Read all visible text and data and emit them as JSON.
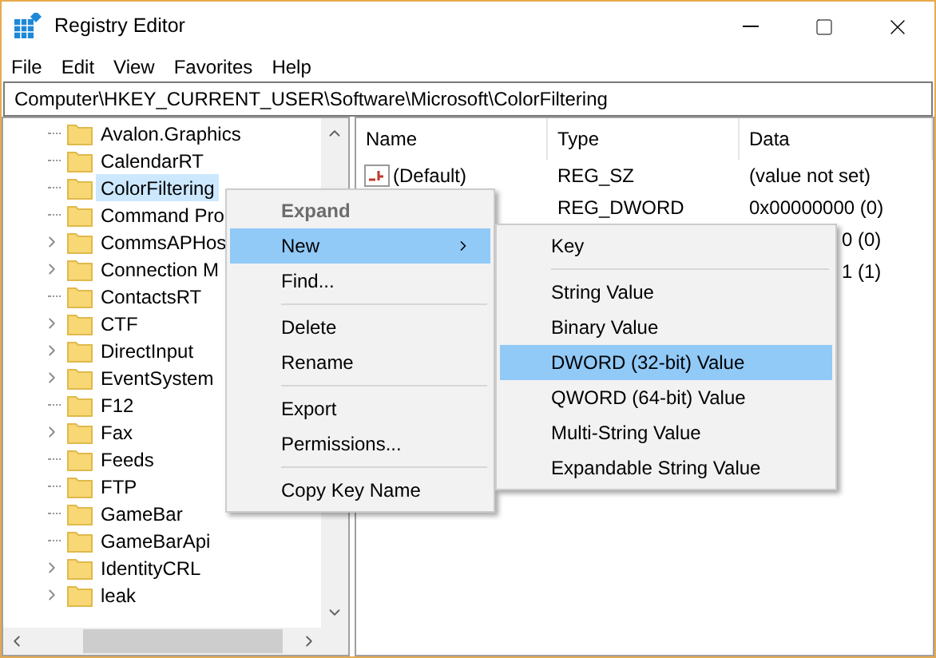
{
  "window": {
    "title": "Registry Editor"
  },
  "menu_bar": [
    "File",
    "Edit",
    "View",
    "Favorites",
    "Help"
  ],
  "address_bar": "Computer\\HKEY_CURRENT_USER\\Software\\Microsoft\\ColorFiltering",
  "tree": {
    "items": [
      {
        "label": "Avalon.Graphics",
        "expandable": false,
        "selected": false
      },
      {
        "label": "CalendarRT",
        "expandable": false,
        "selected": false
      },
      {
        "label": "ColorFiltering",
        "expandable": false,
        "selected": true
      },
      {
        "label": "Command Pro",
        "expandable": false,
        "selected": false
      },
      {
        "label": "CommsAPHos",
        "expandable": true,
        "selected": false
      },
      {
        "label": "Connection M",
        "expandable": true,
        "selected": false
      },
      {
        "label": "ContactsRT",
        "expandable": false,
        "selected": false
      },
      {
        "label": "CTF",
        "expandable": true,
        "selected": false
      },
      {
        "label": "DirectInput",
        "expandable": true,
        "selected": false
      },
      {
        "label": "EventSystem",
        "expandable": true,
        "selected": false
      },
      {
        "label": "F12",
        "expandable": false,
        "selected": false
      },
      {
        "label": "Fax",
        "expandable": true,
        "selected": false
      },
      {
        "label": "Feeds",
        "expandable": false,
        "selected": false
      },
      {
        "label": "FTP",
        "expandable": false,
        "selected": false
      },
      {
        "label": "GameBar",
        "expandable": false,
        "selected": false
      },
      {
        "label": "GameBarApi",
        "expandable": false,
        "selected": false
      },
      {
        "label": "IdentityCRL",
        "expandable": true,
        "selected": false
      },
      {
        "label": "leak",
        "expandable": true,
        "selected": false
      }
    ]
  },
  "values": {
    "columns": [
      "Name",
      "Type",
      "Data"
    ],
    "rows": [
      {
        "kind": "string",
        "name": "(Default)",
        "type": "REG_SZ",
        "data": "(value not set)"
      },
      {
        "kind": "hidden",
        "type": "REG_DWORD",
        "data": "0x00000000 (0)"
      },
      {
        "kind": "hidden",
        "data": "0 (0)"
      },
      {
        "kind": "hidden",
        "data": "1 (1)"
      }
    ]
  },
  "context_menu": {
    "items": [
      {
        "kind": "item",
        "label": "Expand",
        "default": true,
        "disabled": true,
        "selected": false,
        "has_submenu": false
      },
      {
        "kind": "item",
        "label": "New",
        "default": false,
        "disabled": false,
        "selected": true,
        "has_submenu": true
      },
      {
        "kind": "item",
        "label": "Find...",
        "default": false,
        "disabled": false,
        "selected": false,
        "has_submenu": false
      },
      {
        "kind": "separator"
      },
      {
        "kind": "item",
        "label": "Delete",
        "default": false,
        "disabled": false,
        "selected": false,
        "has_submenu": false
      },
      {
        "kind": "item",
        "label": "Rename",
        "default": false,
        "disabled": false,
        "selected": false,
        "has_submenu": false
      },
      {
        "kind": "separator"
      },
      {
        "kind": "item",
        "label": "Export",
        "default": false,
        "disabled": false,
        "selected": false,
        "has_submenu": false
      },
      {
        "kind": "item",
        "label": "Permissions...",
        "default": false,
        "disabled": false,
        "selected": false,
        "has_submenu": false
      },
      {
        "kind": "separator"
      },
      {
        "kind": "item",
        "label": "Copy Key Name",
        "default": false,
        "disabled": false,
        "selected": false,
        "has_submenu": false
      }
    ]
  },
  "submenu": {
    "items": [
      {
        "kind": "item",
        "label": "Key",
        "selected": false
      },
      {
        "kind": "separator"
      },
      {
        "kind": "item",
        "label": "String Value",
        "selected": false
      },
      {
        "kind": "item",
        "label": "Binary Value",
        "selected": false
      },
      {
        "kind": "item",
        "label": "DWORD (32-bit) Value",
        "selected": true
      },
      {
        "kind": "item",
        "label": "QWORD (64-bit) Value",
        "selected": false
      },
      {
        "kind": "item",
        "label": "Multi-String Value",
        "selected": false
      },
      {
        "kind": "item",
        "label": "Expandable String Value",
        "selected": false
      }
    ]
  }
}
